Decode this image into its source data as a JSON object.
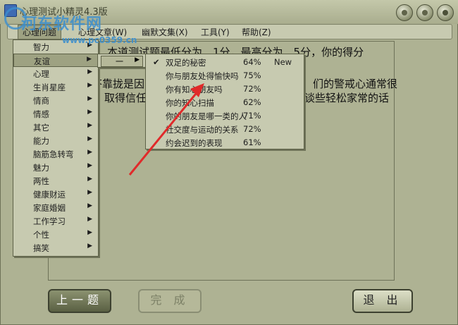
{
  "window": {
    "title": "心理测试小精灵4.3版"
  },
  "watermark": {
    "site": "河东软件网",
    "url": "www.pc0359.cn"
  },
  "menubar": {
    "items": [
      "心理问题",
      "心理文章(W)",
      "幽默文集(X)",
      "工具(Y)",
      "帮助(Z)"
    ]
  },
  "question": {
    "line1": "本道测试题最低分为　1分，最高分为　5分，你的得分",
    "line2a": "答靠拢是因",
    "line2b": "们的警戒心通常很",
    "line3a": "取得信任",
    "line3b": "谈些轻松家常的话"
  },
  "category_menu": {
    "items": [
      "智力",
      "友谊",
      "心理",
      "生肖星座",
      "情商",
      "情感",
      "其它",
      "能力",
      "脑筋急转弯",
      "魅力",
      "两性",
      "健康财运",
      "家庭婚姻",
      "工作学习",
      "个性",
      "搞笑"
    ],
    "selected": "友谊"
  },
  "submenu": {
    "label": "一"
  },
  "tests_menu": {
    "items": [
      {
        "name": "双足的秘密",
        "score": "64%",
        "tag": "New",
        "checked": true
      },
      {
        "name": "你与朋友处得愉快吗",
        "score": "75%",
        "tag": "",
        "checked": false
      },
      {
        "name": "你有知心朋友吗",
        "score": "72%",
        "tag": "",
        "checked": false
      },
      {
        "name": "你的知心扫描",
        "score": "62%",
        "tag": "",
        "checked": false
      },
      {
        "name": "你的朋友是哪一类的人",
        "score": "71%",
        "tag": "",
        "checked": false
      },
      {
        "name": "社交度与运动的关系",
        "score": "72%",
        "tag": "",
        "checked": false
      },
      {
        "name": "约会迟到的表现",
        "score": "61%",
        "tag": "",
        "checked": false
      }
    ]
  },
  "buttons": {
    "prev": "上一题",
    "done": "完 成",
    "exit": "退 出"
  },
  "colors": {
    "window_bg": "#aeb293",
    "menu_bg": "#c7cab0",
    "highlight": "#9ea282",
    "arrow": "#e02a2a",
    "watermark": "#3b8fcf"
  }
}
